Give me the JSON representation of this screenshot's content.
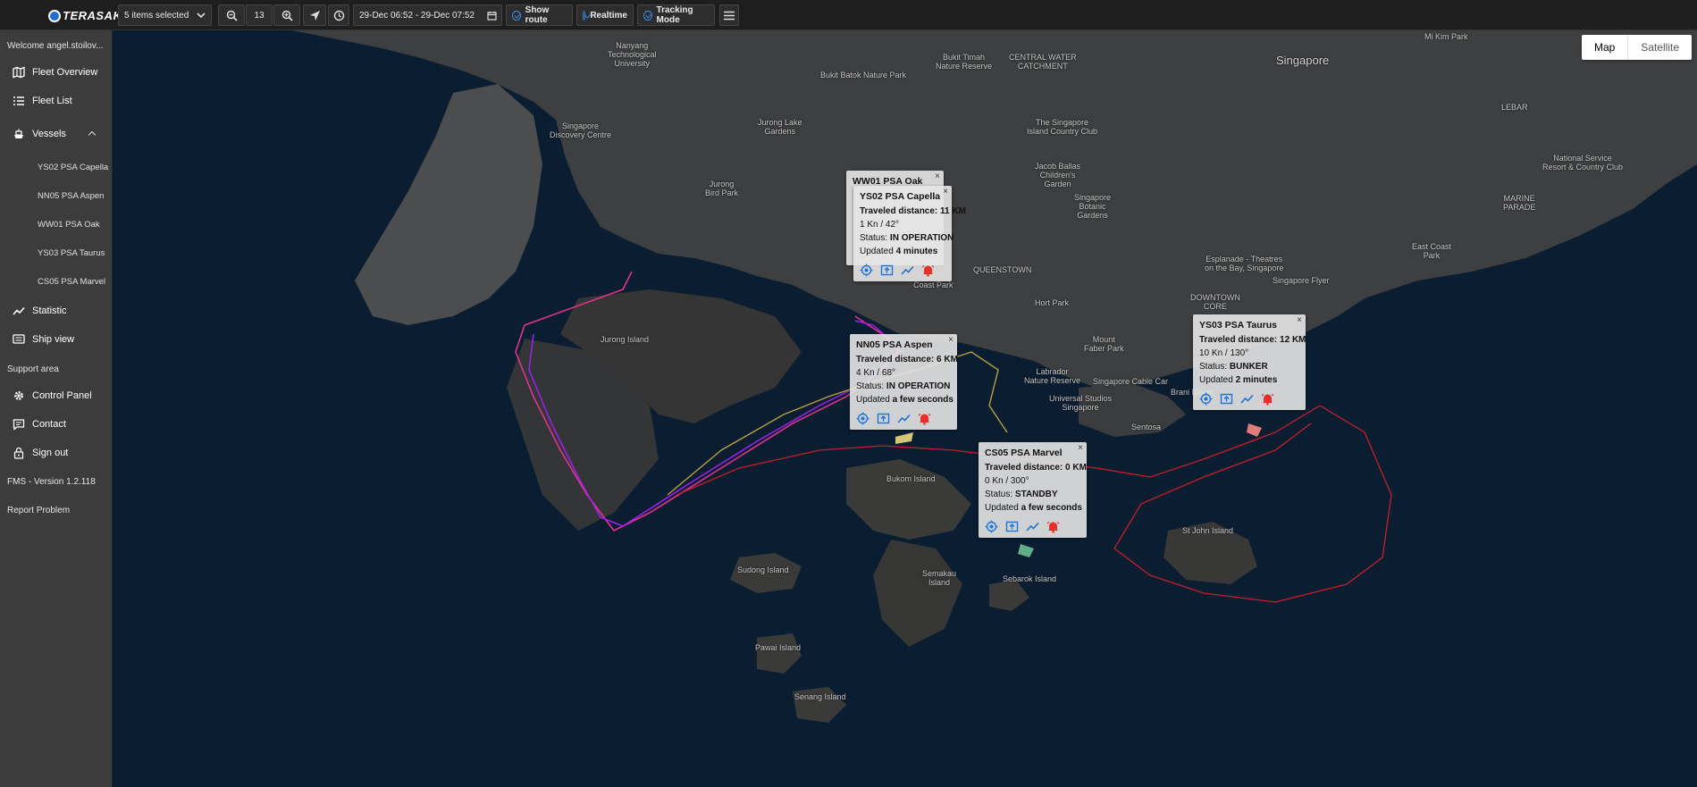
{
  "app": {
    "logo_text": "TERASAKI"
  },
  "toolbar": {
    "vessel_select": "5 items selected",
    "zoom_level": "13",
    "date_range": "29-Dec 06:52 - 29-Dec 07:52",
    "show_route": "Show route",
    "realtime": "Realtime",
    "tracking_mode": "Tracking Mode"
  },
  "sidebar": {
    "welcome": "Welcome angel.stoilov...",
    "fleet_overview": "Fleet Overview",
    "fleet_list": "Fleet List",
    "vessels": "Vessels",
    "vessel_items": [
      "YS02 PSA Capella",
      "NN05 PSA Aspen",
      "WW01 PSA Oak",
      "YS03 PSA Taurus",
      "CS05 PSA Marvel"
    ],
    "statistic": "Statistic",
    "ship_view": "Ship view",
    "support_area": "Support area",
    "control_panel": "Control Panel",
    "contact": "Contact",
    "sign_out": "Sign out",
    "version": "FMS - Version 1.2.118",
    "report_problem": "Report Problem"
  },
  "map": {
    "type_map": "Map",
    "type_satellite": "Satellite",
    "places": {
      "singapore": "Singapore",
      "jurong_island": "Jurong Island",
      "bukom": "Bukom Island",
      "sudong": "Sudong Island",
      "semakau": "Semakau\nIsland",
      "sebarok": "Sebarok Island",
      "pawai": "Pawai Island",
      "senang": "Senang Island",
      "st_john": "St John Island",
      "sentosa": "Sentosa",
      "brani": "Brani Island",
      "labrador": "Labrador\nNature Reserve",
      "universal": "Universal Studios\nSingapore",
      "mount_faber": "Mount\nFaber Park",
      "cable_car": "Singapore Cable Car",
      "hort_park": "Hort Park",
      "ntu": "Nanyang\nTechnological\nUniversity",
      "discovery": "Singapore\nDiscovery Centre",
      "jurong_bird": "Jurong\nBird Park",
      "jurong_lake": "Jurong Lake\nGardens",
      "bukit_batok": "Bukit Batok Nature Park",
      "bukit_timah": "Bukit Timah\nNature Reserve",
      "central_water": "CENTRAL WATER\nCATCHMENT",
      "country_club": "The Singapore\nIsland Country Club",
      "botanic": "Singapore\nBotanic\nGardens",
      "jacob_ballas": "Jacob Ballas\nChildren's\nGarden",
      "esplanade": "Esplanade - Theatres\non the Bay, Singapore",
      "flyer": "Singapore Flyer",
      "downtown": "DOWNTOWN\nCORE",
      "east_coast": "East Coast\nPark",
      "national_service": "National Service\nResort & Country Club",
      "queenstown": "QUEENSTOWN",
      "coast_park": "Coast Park",
      "mi_kim": "Mi Kim Park",
      "lebar": "LEBAR",
      "marine_parade": "MARINE\nPARADE"
    }
  },
  "popups": [
    {
      "id": "ww01",
      "name": "WW01 PSA Oak"
    },
    {
      "id": "ys02",
      "name": "YS02 PSA Capella",
      "distance": "Traveled distance: 11 KM",
      "speed": "1 Kn / 42°",
      "status_label": "Status:",
      "status": "IN OPERATION",
      "updated_label": "Updated",
      "updated": "4 minutes"
    },
    {
      "id": "nn05",
      "name": "NN05 PSA Aspen",
      "distance": "Traveled distance: 6 KM",
      "speed": "4 Kn / 68°",
      "status_label": "Status:",
      "status": "IN OPERATION",
      "updated_label": "Updated",
      "updated": "a few seconds"
    },
    {
      "id": "ys03",
      "name": "YS03 PSA Taurus",
      "distance": "Traveled distance: 12 KM",
      "speed": "10 Kn / 130°",
      "status_label": "Status:",
      "status": "BUNKER",
      "updated_label": "Updated",
      "updated": "2 minutes"
    },
    {
      "id": "cs05",
      "name": "CS05 PSA Marvel",
      "distance": "Traveled distance: 0 KM",
      "speed": "0 Kn / 300°",
      "status_label": "Status:",
      "status": "STANDBY",
      "updated_label": "Updated",
      "updated": "a few seconds"
    }
  ],
  "colors": {
    "route_pink": "#e0338f",
    "route_purple": "#a020f0",
    "route_olive": "#b8a040",
    "route_red": "#c21f2a",
    "icon_blue": "#1e73d8",
    "icon_red": "#e5302a"
  }
}
